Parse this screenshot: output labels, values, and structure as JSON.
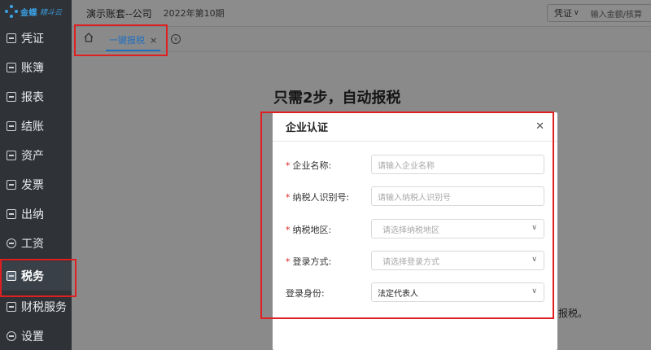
{
  "sidebar": {
    "logo": {
      "name": "金蝶",
      "sub": "精斗云"
    },
    "items": [
      {
        "label": "凭证"
      },
      {
        "label": "账簿"
      },
      {
        "label": "报表"
      },
      {
        "label": "结账"
      },
      {
        "label": "资产"
      },
      {
        "label": "发票"
      },
      {
        "label": "出纳"
      },
      {
        "label": "工资"
      },
      {
        "label": "税务"
      },
      {
        "label": "财税服务"
      },
      {
        "label": "设置"
      }
    ],
    "active_index": 8
  },
  "topbar": {
    "company": "演示账套--公司",
    "period": "2022年第10期",
    "voucher_select": "凭证",
    "search_placeholder": "输入金额/核算"
  },
  "tabs": {
    "items": [
      {
        "label": "一键报税"
      }
    ]
  },
  "main": {
    "headline": "只需2步，自动报税",
    "tail_text": "报税。"
  },
  "modal": {
    "title": "企业认证",
    "fields": [
      {
        "label": "企业名称:",
        "required": true,
        "placeholder": "请输入企业名称",
        "type": "input"
      },
      {
        "label": "纳税人识别号:",
        "required": true,
        "placeholder": "请输入纳税人识别号",
        "type": "input"
      },
      {
        "label": "纳税地区:",
        "required": true,
        "placeholder": "请选择纳税地区",
        "type": "select"
      },
      {
        "label": "登录方式:",
        "required": true,
        "placeholder": "请选择登录方式",
        "type": "select"
      },
      {
        "label": "登录身份:",
        "required": false,
        "value": "法定代表人",
        "type": "select"
      }
    ]
  },
  "colors": {
    "highlight": "#e02020",
    "accent": "#1f6fbf",
    "sidebar": "#2f3338"
  }
}
